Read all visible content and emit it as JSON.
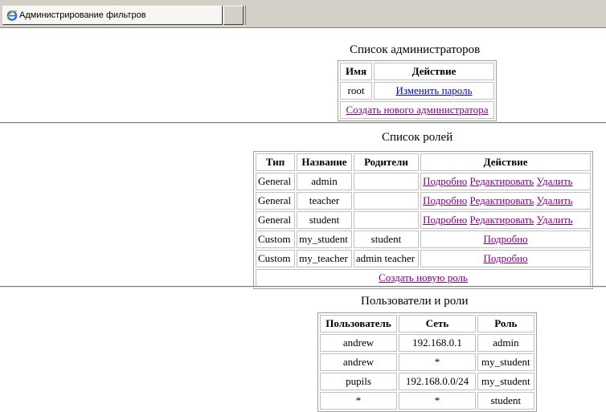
{
  "tab": {
    "title": "Администрирование фильтров",
    "icon": "ie-icon"
  },
  "admins": {
    "title": "Список администраторов",
    "headers": [
      "Имя",
      "Действие"
    ],
    "rows": [
      {
        "name": "root",
        "action": "Изменить пароль"
      }
    ],
    "create": "Создать нового администратора"
  },
  "roles": {
    "title": "Список ролей",
    "headers": [
      "Тип",
      "Название",
      "Родители",
      "Действие"
    ],
    "rows": [
      {
        "type": "General",
        "name": "admin",
        "parents": "",
        "details": "Подробно",
        "edit": "Редактировать",
        "delete": "Удалить"
      },
      {
        "type": "General",
        "name": "teacher",
        "parents": "",
        "details": "Подробно",
        "edit": "Редактировать",
        "delete": "Удалить"
      },
      {
        "type": "General",
        "name": "student",
        "parents": "",
        "details": "Подробно",
        "edit": "Редактировать",
        "delete": "Удалить"
      },
      {
        "type": "Custom",
        "name": "my_student",
        "parents": "student",
        "details": "Подробно"
      },
      {
        "type": "Custom",
        "name": "my_teacher",
        "parents": "admin teacher",
        "details": "Подробно"
      }
    ],
    "create": "Создать новую роль"
  },
  "users": {
    "title": "Пользователи и роли",
    "headers": [
      "Пользователь",
      "Сеть",
      "Роль"
    ],
    "rows": [
      {
        "user": "andrew",
        "net": "192.168.0.1",
        "role": "admin"
      },
      {
        "user": "andrew",
        "net": "*",
        "role": "my_student"
      },
      {
        "user": "pupils",
        "net": "192.168.0.0/24",
        "role": "my_student"
      },
      {
        "user": "*",
        "net": "*",
        "role": "student"
      }
    ]
  },
  "colors": {
    "link_visited": "#800080",
    "link": "#0000cc",
    "chrome": "#d4d0c8"
  }
}
